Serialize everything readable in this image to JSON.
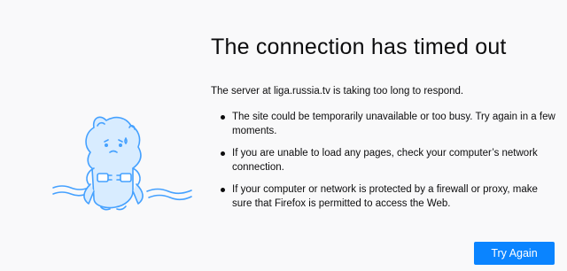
{
  "error": {
    "title": "The connection has timed out",
    "subtitle": "The server at liga.russia.tv is taking too long to respond.",
    "reasons": [
      "The site could be temporarily unavailable or too busy. Try again in a few moments.",
      "If you are unable to load any pages, check your computer’s network connection.",
      "If your computer or network is protected by a firewall or proxy, make sure that Firefox is permitted to access the Web."
    ],
    "try_again_label": "Try Again"
  },
  "illustration": {
    "icon": "unplugged-creature-icon",
    "stroke_color": "#45a1ff",
    "fill_color": "#d8ecff"
  },
  "colors": {
    "background": "#f9f9fa",
    "button": "#0a84ff",
    "button_text": "#ffffff",
    "text": "#0c0c0d"
  }
}
